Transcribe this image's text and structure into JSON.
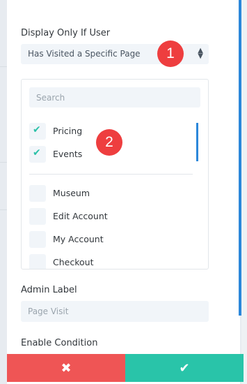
{
  "display_condition": {
    "label": "Display Only If User",
    "selected": "Has Visited a Specific Page",
    "arrows": "▲▼"
  },
  "callouts": [
    "1",
    "2"
  ],
  "pages": {
    "search_placeholder": "Search",
    "checked": [
      {
        "label": "Pricing",
        "checked": true
      },
      {
        "label": "Events",
        "checked": true
      }
    ],
    "unchecked": [
      {
        "label": "Museum",
        "checked": false
      },
      {
        "label": "Edit Account",
        "checked": false
      },
      {
        "label": "My Account",
        "checked": false
      },
      {
        "label": "Checkout",
        "checked": false
      }
    ]
  },
  "admin_label": {
    "label": "Admin Label",
    "placeholder": "Page Visit"
  },
  "enable_condition": {
    "label": "Enable Condition"
  },
  "actions": {
    "cancel_icon": "✖",
    "save_icon": "✔"
  },
  "colors": {
    "accent_blue": "#2b87da",
    "check_green": "#2cc1a8",
    "badge_red": "#ee3e3f",
    "cancel_red": "#ef5555",
    "save_green": "#29c4a9"
  },
  "icons": {
    "check": "check-icon",
    "cancel": "close-icon",
    "save": "checkmark-icon"
  }
}
